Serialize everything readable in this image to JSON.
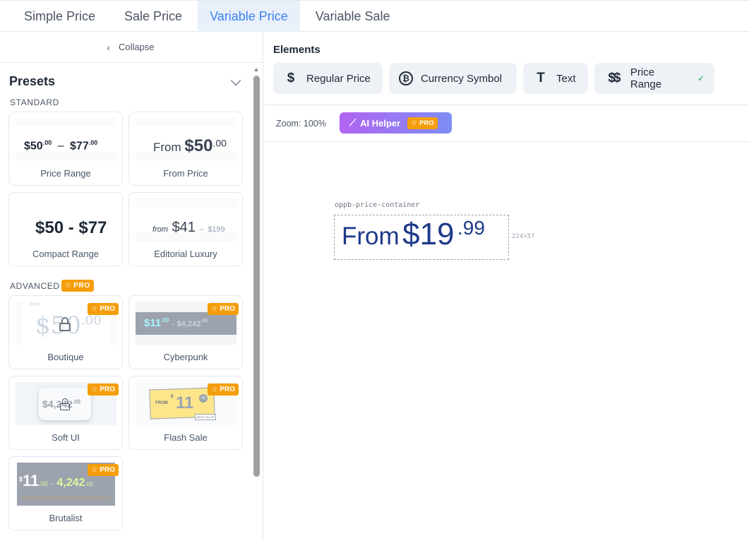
{
  "tabs": [
    "Simple Price",
    "Sale Price",
    "Variable Price",
    "Variable Sale"
  ],
  "active_tab": "Variable Price",
  "sidebar": {
    "collapse_label": "Collapse",
    "presets_title": "Presets",
    "standard_label": "STANDARD",
    "advanced_label": "ADVANCED",
    "pro_label": "PRO",
    "presets": {
      "price_range": {
        "label": "Price Range",
        "main": "$50",
        "cents1": ".00",
        "sep": "–",
        "main2": "$77",
        "cents2": ".00"
      },
      "from_price": {
        "label": "From Price",
        "prefix": "From",
        "main": "$50",
        "cents": ".00"
      },
      "compact_range": {
        "label": "Compact Range",
        "text": "$50 - $77"
      },
      "editorial_luxury": {
        "label": "Editorial Luxury",
        "prefix": "from",
        "main": "$41",
        "sep": "–",
        "max": "$199"
      },
      "boutique": {
        "label": "Boutique",
        "text": "$50",
        "cents": ".00",
        "small": "from"
      },
      "cyberpunk": {
        "label": "Cyberpunk",
        "main": "$11",
        "cents": ".00",
        "sep": "-",
        "max": "$4,242",
        "max_cents": ".00"
      },
      "soft_ui": {
        "label": "Soft UI",
        "text": "$4,242",
        "cents": ".00"
      },
      "flash_sale": {
        "label": "Flash Sale",
        "from": "FROM",
        "currency": "$",
        "main": "11",
        "cents": "00",
        "tag": "BEST VALUE"
      },
      "brutalist": {
        "label": "Brutalist",
        "currency": "$",
        "main": "11",
        "cents": ".00",
        "sep": "-",
        "max": "4,242",
        "max_cents": ".00"
      }
    }
  },
  "main": {
    "elements_title": "Elements",
    "elements": [
      {
        "label": "Regular Price",
        "icon": "dollar-icon"
      },
      {
        "label": "Currency Symbol",
        "icon": "bitcoin-icon"
      },
      {
        "label": "Text",
        "icon": "text-icon"
      },
      {
        "label": "Price Range",
        "icon": "double-dollar-icon",
        "checked": true
      }
    ],
    "zoom_label": "Zoom: 100%",
    "ai_helper_label": "AI Helper",
    "canvas": {
      "container_label": "oppb-price-container",
      "prefix": "From",
      "amount": "$19",
      "cents": ".99",
      "dims": "224×57"
    }
  },
  "colors": {
    "accent": "#3b82f6",
    "pro": "#f59e0b",
    "price": "#1e3a8a"
  }
}
